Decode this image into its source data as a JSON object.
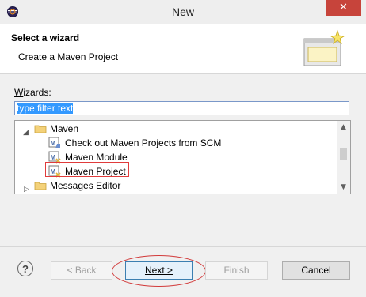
{
  "window": {
    "title": "New",
    "close_label": "✕"
  },
  "header": {
    "title": "Select a wizard",
    "description": "Create a Maven Project"
  },
  "filter": {
    "label_access_key": "W",
    "label_rest": "izards:",
    "value": "type filter text"
  },
  "tree": {
    "items": [
      {
        "label": "Maven",
        "expanded": true,
        "icon": "folder-icon"
      },
      {
        "label": "Check out Maven Projects from SCM",
        "icon": "maven-wizard-icon"
      },
      {
        "label": "Maven Module",
        "icon": "maven-wizard-icon"
      },
      {
        "label": "Maven Project",
        "icon": "maven-wizard-icon",
        "selected": true
      },
      {
        "label": "Messages Editor",
        "expanded": false,
        "icon": "folder-icon"
      }
    ]
  },
  "buttons": {
    "help": "?",
    "back": "< Back",
    "next": "Next >",
    "finish": "Finish",
    "cancel": "Cancel"
  },
  "colors": {
    "highlight_red": "#d23b3b",
    "selection_blue": "#3399ff",
    "close_red": "#c7443b"
  }
}
